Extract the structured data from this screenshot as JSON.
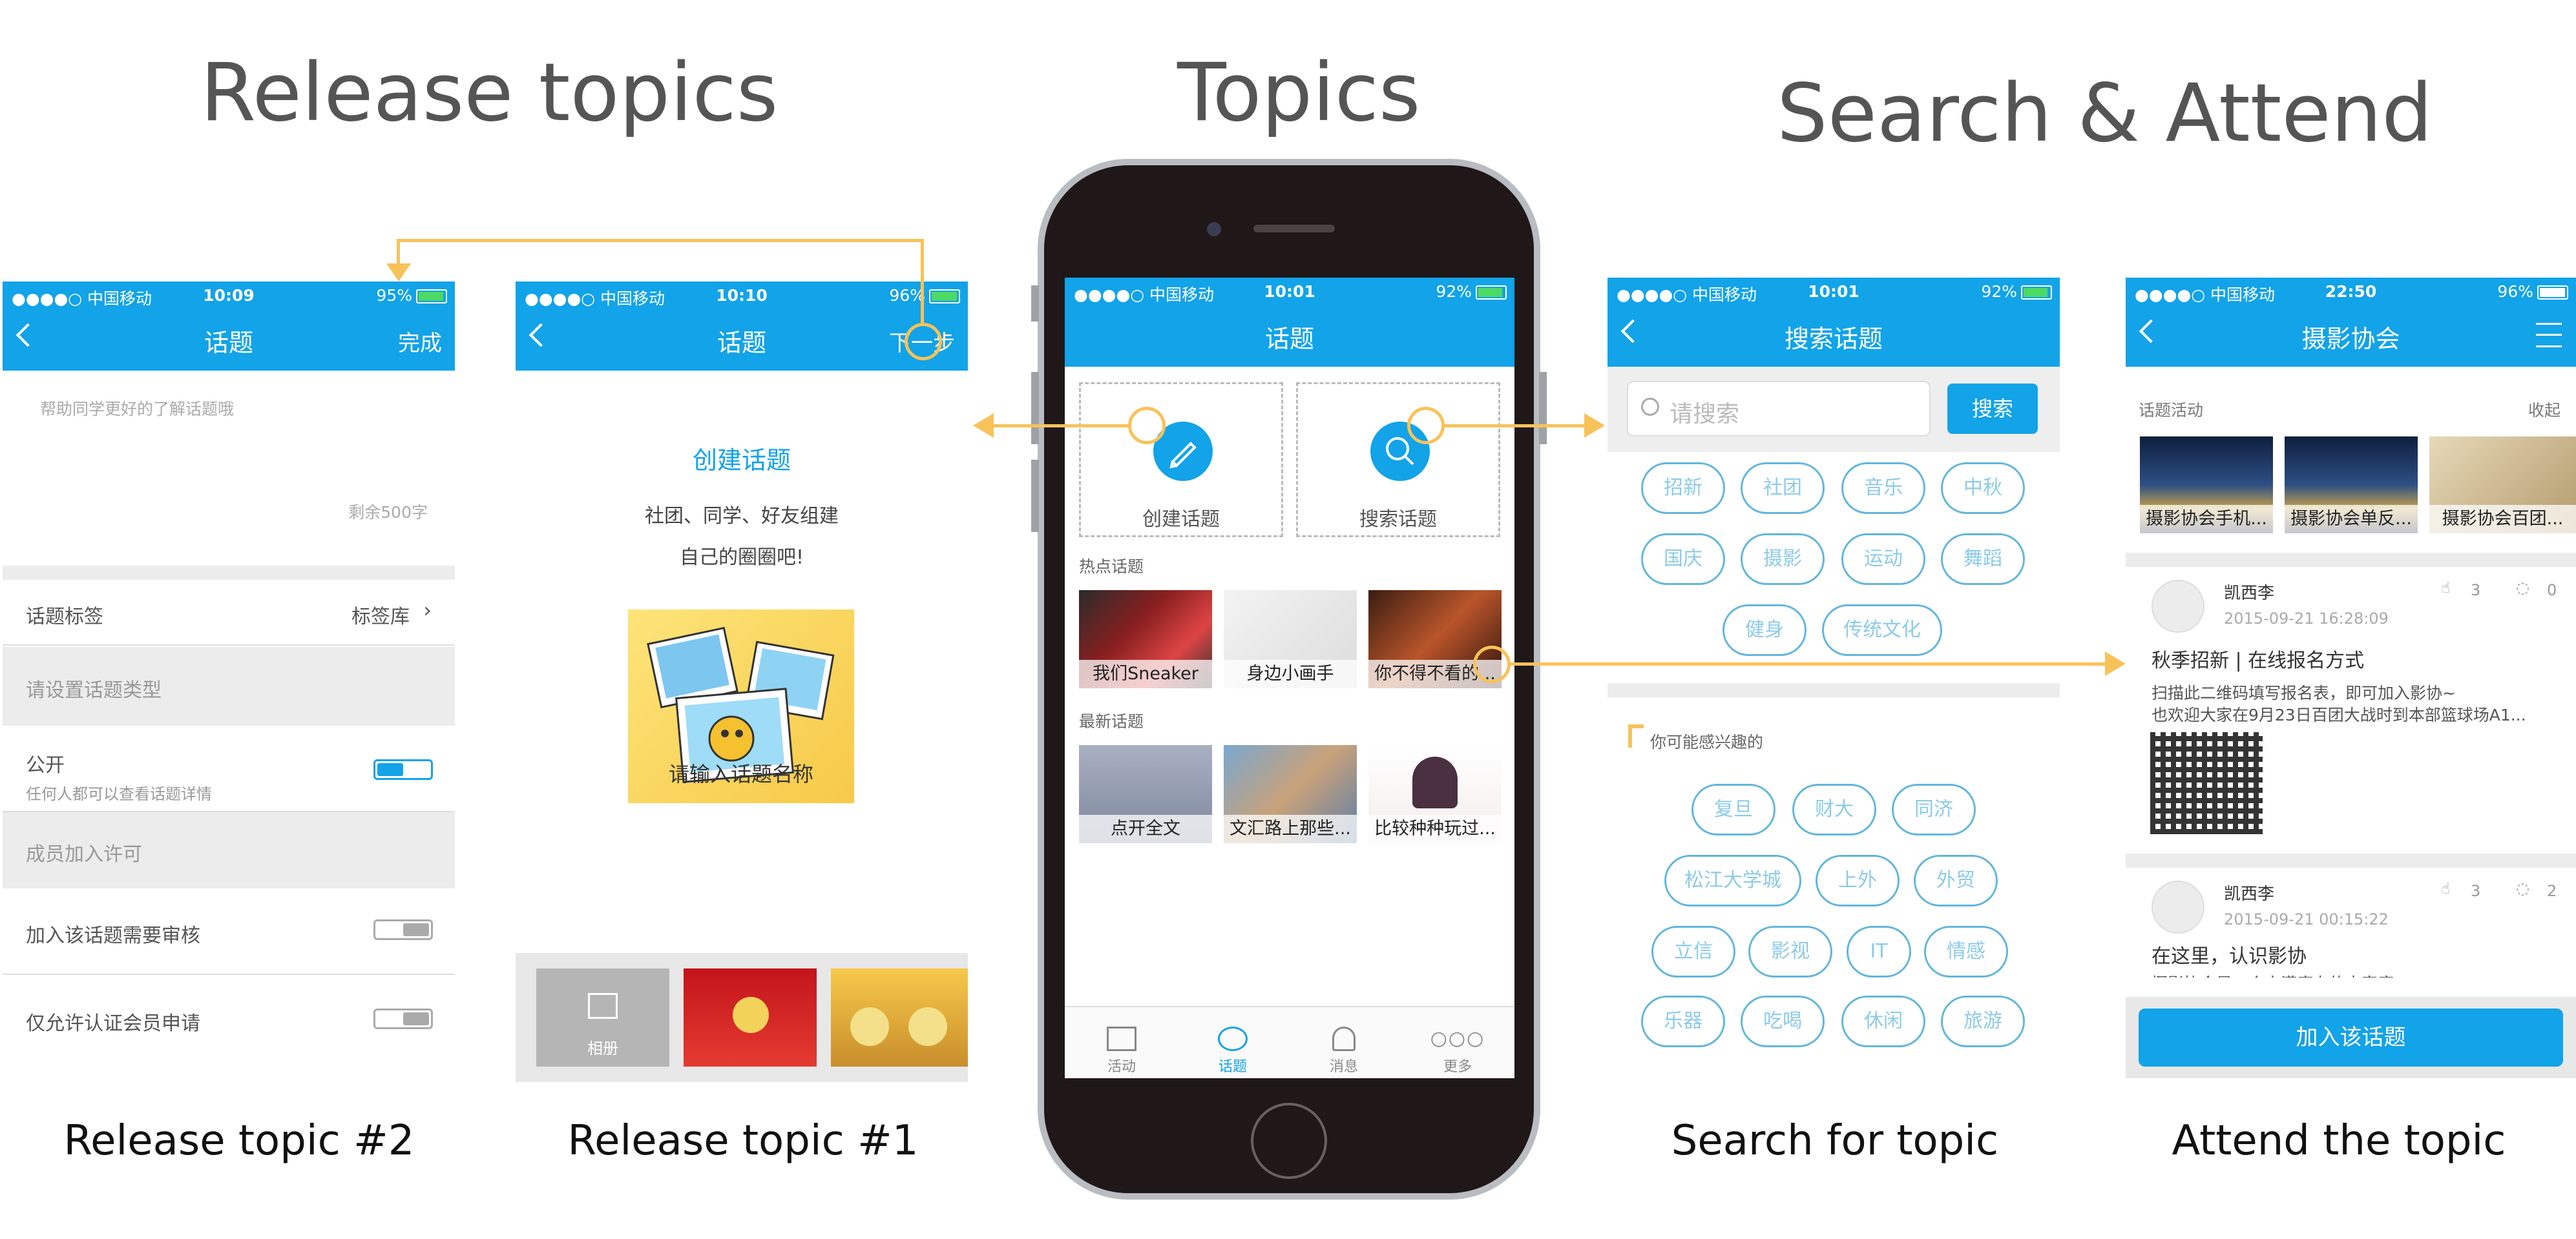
{
  "headings": {
    "release": "Release topics",
    "topics": "Topics",
    "search": "Search & Attend"
  },
  "captions": {
    "release2": "Release topic #2",
    "release1": "Release topic #1",
    "search": "Search for topic",
    "attend": "Attend the topic"
  },
  "colors": {
    "brand": "#12a3e8",
    "arrow": "#f8c25a",
    "tag_border": "#62b6dd"
  },
  "screen_release2": {
    "status": {
      "carrier": "●●●●○ 中国移动",
      "time": "10:09",
      "battery": "95%"
    },
    "nav": {
      "title": "话题",
      "right": "完成"
    },
    "hint": "帮助同学更好的了解话题哦",
    "remaining": "剩余500字",
    "tags_label": "话题标签",
    "tags_value": "标签库",
    "type_placeholder": "请设置话题类型",
    "public_label": "公开",
    "public_desc": "任何人都可以查看话题详情",
    "public_on": true,
    "member_label": "成员加入许可",
    "review_label": "加入该话题需要审核",
    "certified_label": "仅允许认证会员申请"
  },
  "screen_release1": {
    "status": {
      "carrier": "●●●●○ 中国移动",
      "time": "10:10",
      "battery": "96%"
    },
    "nav": {
      "title": "话题",
      "right": "下一步"
    },
    "create_title": "创建话题",
    "line1": "社团、同学、好友组建",
    "line2": "自己的圈圈吧!",
    "name_placeholder": "请输入话题名称",
    "album_label": "相册"
  },
  "screen_topics": {
    "status": {
      "carrier": "●●●●○ 中国移动",
      "time": "10:01",
      "battery": "92%"
    },
    "nav": {
      "title": "话题"
    },
    "create_label": "创建话题",
    "search_label": "搜索话题",
    "hot_title": "热点话题",
    "hot": [
      "我们Sneaker",
      "身边小画手",
      "你不得不看的..."
    ],
    "new_title": "最新话题",
    "new": [
      "点开全文",
      "文汇路上那些...",
      "比较种种玩过..."
    ],
    "tabs": [
      {
        "label": "活动",
        "icon": "map-icon"
      },
      {
        "label": "话题",
        "icon": "chat-icon"
      },
      {
        "label": "消息",
        "icon": "bell-icon"
      },
      {
        "label": "更多",
        "icon": "more-icon"
      }
    ],
    "active_tab": "话题"
  },
  "screen_search": {
    "status": {
      "carrier": "●●●●○ 中国移动",
      "time": "10:01",
      "battery": "92%"
    },
    "nav": {
      "title": "搜索话题"
    },
    "search_placeholder": "请搜索",
    "search_button": "搜索",
    "tags": [
      "招新",
      "社团",
      "音乐",
      "中秋",
      "国庆",
      "摄影",
      "运动",
      "舞蹈",
      "健身",
      "传统文化"
    ],
    "interest_title": "你可能感兴趣的",
    "interest": [
      "复旦",
      "财大",
      "同济",
      "松江大学城",
      "上外",
      "外贸",
      "立信",
      "影视",
      "IT",
      "情感",
      "乐器",
      "吃喝",
      "休闲",
      "旅游"
    ]
  },
  "screen_attend": {
    "status": {
      "carrier": "●●●●○ 中国移动",
      "time": "22:50",
      "battery": "96%"
    },
    "nav": {
      "title": "摄影协会"
    },
    "activity_label": "话题活动",
    "collapse_label": "收起",
    "activities": [
      "摄影协会手机...",
      "摄影协会单反...",
      "摄影协会百团..."
    ],
    "posts": [
      {
        "author": "凯西李",
        "time": "2015-09-21 16:28:09",
        "likes": "3",
        "comments": "0",
        "title": "秋季招新 | 在线报名方式",
        "body1": "扫描此二维码填写报名表，即可加入影协~",
        "body2": "也欢迎大家在9月23日百团大战时到本部篮球场A1..."
      },
      {
        "author": "凯西李",
        "time": "2015-09-21 00:15:22",
        "likes": "3",
        "comments": "2",
        "title": "在这里，认识影协",
        "body1": "摄影协会是一个充满魔力的大家庭..."
      }
    ],
    "join_button": "加入该话题"
  }
}
